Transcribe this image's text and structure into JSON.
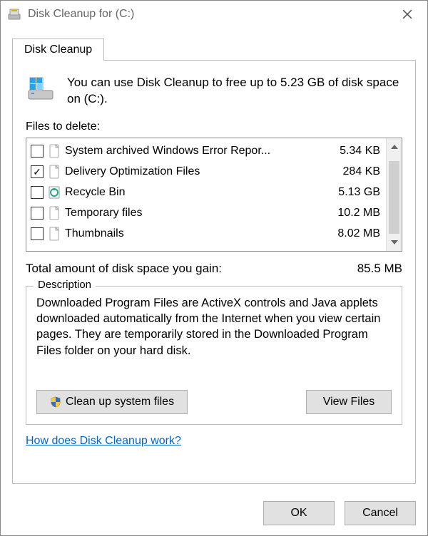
{
  "window": {
    "title": "Disk Cleanup for  (C:)"
  },
  "tab": {
    "label": "Disk Cleanup"
  },
  "intro": {
    "text": "You can use Disk Cleanup to free up to 5.23 GB of disk space on  (C:)."
  },
  "files_label": "Files to delete:",
  "files": [
    {
      "label": "System archived Windows Error Repor...",
      "size": "5.34 KB",
      "checked": false,
      "icon": "file"
    },
    {
      "label": "Delivery Optimization Files",
      "size": "284 KB",
      "checked": true,
      "icon": "file"
    },
    {
      "label": "Recycle Bin",
      "size": "5.13 GB",
      "checked": false,
      "icon": "recycle"
    },
    {
      "label": "Temporary files",
      "size": "10.2 MB",
      "checked": false,
      "icon": "file"
    },
    {
      "label": "Thumbnails",
      "size": "8.02 MB",
      "checked": false,
      "icon": "file"
    }
  ],
  "total": {
    "label": "Total amount of disk space you gain:",
    "value": "85.5 MB"
  },
  "description": {
    "legend": "Description",
    "text": "Downloaded Program Files are ActiveX controls and Java applets downloaded automatically from the Internet when you view certain pages. They are temporarily stored in the Downloaded Program Files folder on your hard disk."
  },
  "buttons": {
    "cleanup_system": "Clean up system files",
    "view_files": "View Files",
    "ok": "OK",
    "cancel": "Cancel"
  },
  "help_link": "How does Disk Cleanup work?"
}
